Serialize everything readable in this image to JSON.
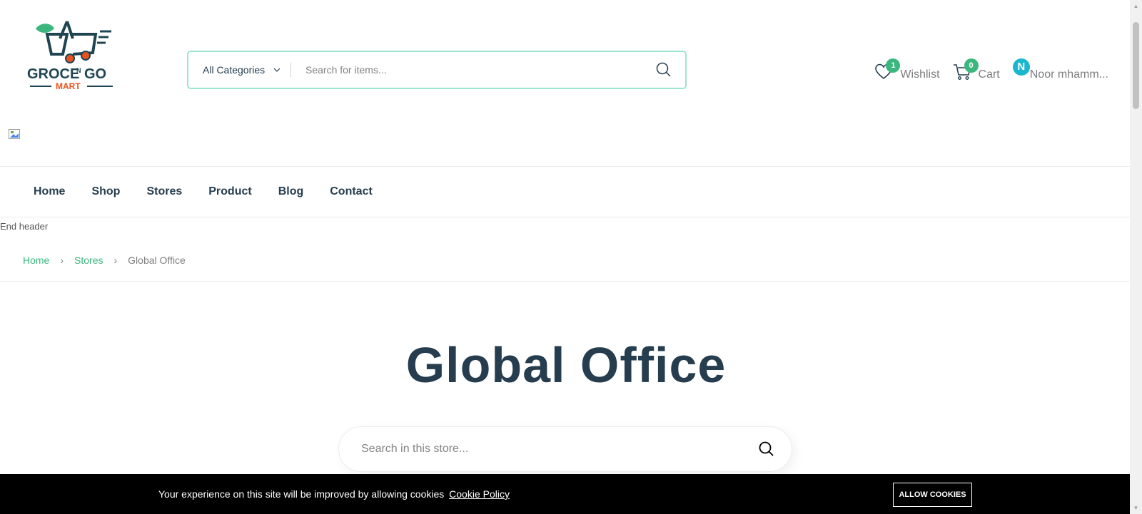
{
  "header": {
    "logo_text": "GROCE N GO MART",
    "category_select": "All Categories",
    "search_placeholder": "Search for items...",
    "wishlist": {
      "label": "Wishlist",
      "count": "1"
    },
    "cart": {
      "label": "Cart",
      "count": "0"
    },
    "user": {
      "initial": "N",
      "name": "Noor mhamm..."
    }
  },
  "nav": {
    "items": [
      {
        "label": "Home"
      },
      {
        "label": "Shop"
      },
      {
        "label": "Stores"
      },
      {
        "label": "Product"
      },
      {
        "label": "Blog"
      },
      {
        "label": "Contact"
      }
    ]
  },
  "end_header_text": "End header",
  "breadcrumb": {
    "items": [
      {
        "label": "Home"
      },
      {
        "label": "Stores"
      },
      {
        "label": "Global Office"
      }
    ],
    "separator": "›"
  },
  "page": {
    "title": "Global Office",
    "store_search_placeholder": "Search in this store..."
  },
  "cookie": {
    "text": "Your experience on this site will be improved by allowing cookies",
    "link": "Cookie Policy",
    "button": "ALLOW COOKIES"
  },
  "colors": {
    "brand_green": "#3bb77e",
    "heading": "#253d4e",
    "avatar": "#1ab8cf",
    "search_border": "#9be6cc"
  }
}
